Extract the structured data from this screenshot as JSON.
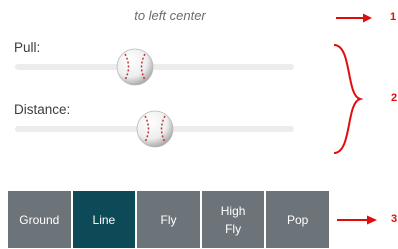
{
  "direction_label": "to left center",
  "sliders": [
    {
      "label": "Pull:",
      "value": 0.43
    },
    {
      "label": "Distance:",
      "value": 0.5
    }
  ],
  "hit_types": [
    {
      "label": "Ground"
    },
    {
      "label": "Line"
    },
    {
      "label": "Fly"
    },
    {
      "label": "High\nFly"
    },
    {
      "label": "Pop"
    }
  ],
  "selected_hit_type": "Line",
  "annotations": [
    {
      "number": "1"
    },
    {
      "number": "2"
    },
    {
      "number": "3"
    }
  ],
  "colors": {
    "accent": "#e30c0c",
    "button": "#6d7479",
    "button_selected": "#0c4a57",
    "track": "#ececec"
  },
  "icons": {
    "slider_thumb": "baseball-icon"
  }
}
